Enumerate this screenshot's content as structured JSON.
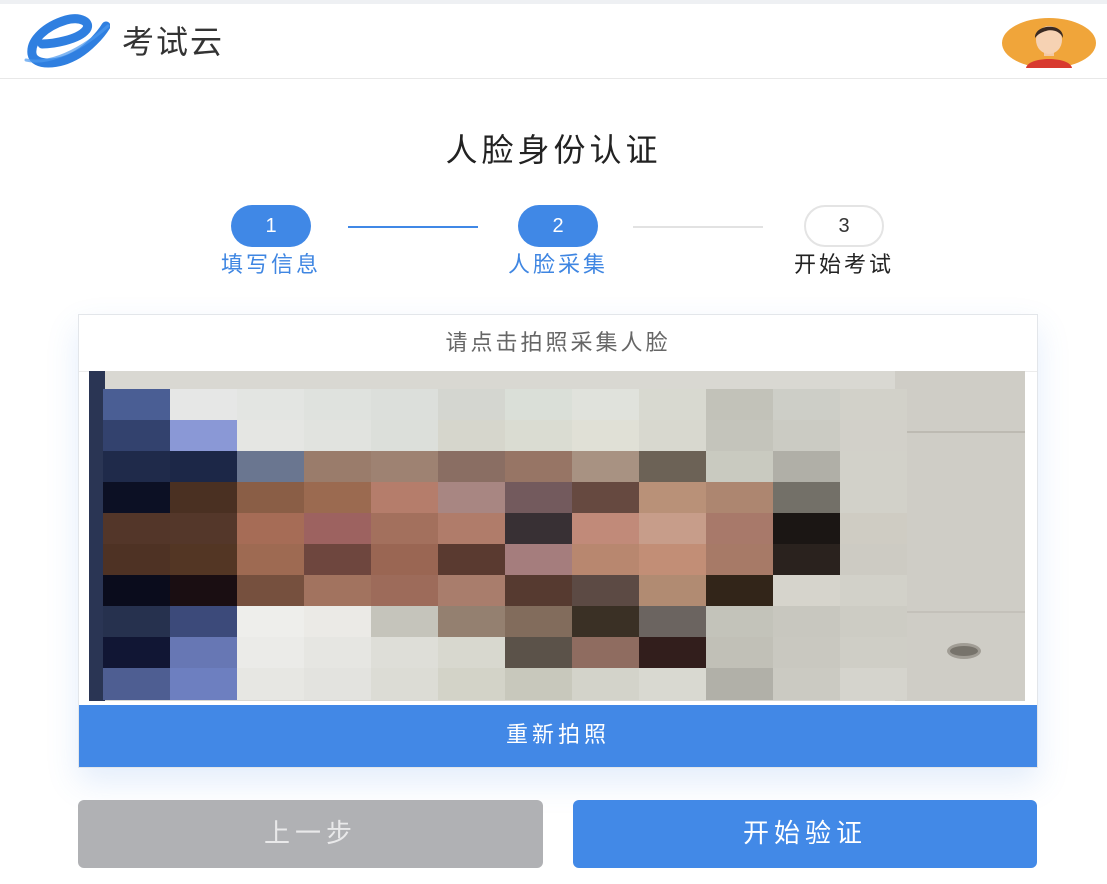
{
  "header": {
    "logo_letter": "e",
    "app_name": "考试云",
    "avatar_icon": "user-avatar-icon"
  },
  "page": {
    "title": "人脸身份认证"
  },
  "steps": [
    {
      "number": "1",
      "label": "填写信息",
      "state": "done"
    },
    {
      "number": "2",
      "label": "人脸采集",
      "state": "done"
    },
    {
      "number": "3",
      "label": "开始考试",
      "state": "todo"
    }
  ],
  "capture": {
    "hint": "请点击拍照采集人脸",
    "retake_label": "重新拍照"
  },
  "actions": {
    "prev_label": "上一步",
    "verify_label": "开始验证"
  },
  "colors": {
    "accent": "#4288e6",
    "disabled": "#b0b1b4"
  }
}
